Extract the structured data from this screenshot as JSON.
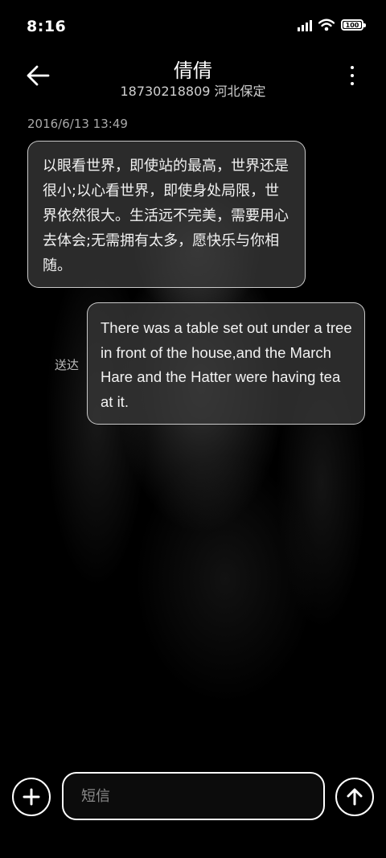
{
  "status": {
    "time": "8:16",
    "battery": "100",
    "icons": [
      "signal-icon",
      "wifi-icon",
      "battery-icon"
    ]
  },
  "header": {
    "contact_name": "倩倩",
    "contact_subtitle": "18730218809 河北保定",
    "back_icon": "arrow-left-icon",
    "more_icon": "more-vertical-icon"
  },
  "conversation": {
    "timestamp": "2016/6/13 13:49",
    "messages": [
      {
        "direction": "incoming",
        "text": "以眼看世界，即使站的最高，世界还是很小;以心看世界，即使身处局限，世界依然很大。生活远不完美，需要用心去体会;无需拥有太多，愿快乐与你相随。"
      },
      {
        "direction": "outgoing",
        "status": "送达",
        "text": "There was a table set out under a tree in front of the house,and the March Hare and the Hatter were having tea at it."
      }
    ]
  },
  "composer": {
    "placeholder": "短信",
    "value": "",
    "add_icon": "plus-icon",
    "send_icon": "arrow-up-icon"
  },
  "colors": {
    "background": "#000000",
    "bubble": "#373737",
    "text": "#ffffff",
    "secondary_text": "#a9a9a9"
  }
}
